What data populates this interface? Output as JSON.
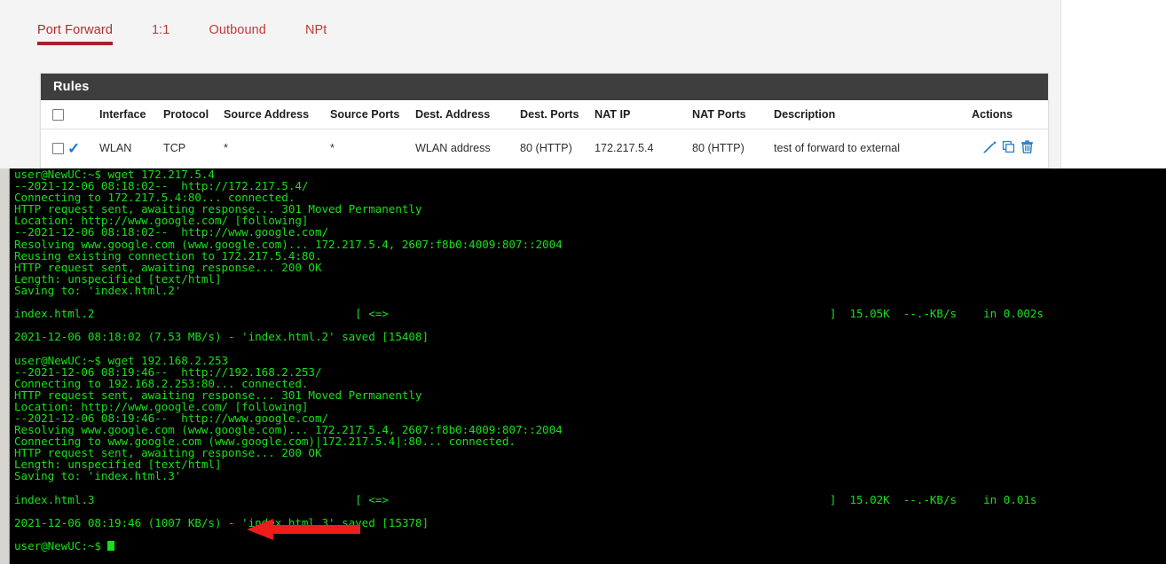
{
  "tabs": [
    {
      "label": "Port Forward",
      "active": true
    },
    {
      "label": "1:1",
      "active": false
    },
    {
      "label": "Outbound",
      "active": false
    },
    {
      "label": "NPt",
      "active": false
    }
  ],
  "rules_card": {
    "title": "Rules",
    "columns": [
      "",
      "",
      "Interface",
      "Protocol",
      "Source Address",
      "Source Ports",
      "Dest. Address",
      "Dest. Ports",
      "NAT IP",
      "NAT Ports",
      "Description",
      "Actions"
    ],
    "rows": [
      {
        "enabled": true,
        "interface": "WLAN",
        "protocol": "TCP",
        "source_address": "*",
        "source_ports": "*",
        "dest_address": "WLAN address",
        "dest_ports": "80 (HTTP)",
        "nat_ip": "172.217.5.4",
        "nat_ports": "80 (HTTP)",
        "description": "test of forward to external",
        "actions": [
          "edit-icon",
          "copy-icon",
          "delete-icon"
        ]
      }
    ]
  },
  "terminal": {
    "prompt": "user@NewUC:~$",
    "lines": [
      "user@NewUC:~$ wget 172.217.5.4",
      "--2021-12-06 08:18:02--  http://172.217.5.4/",
      "Connecting to 172.217.5.4:80... connected.",
      "HTTP request sent, awaiting response... 301 Moved Permanently",
      "Location: http://www.google.com/ [following]",
      "--2021-12-06 08:18:02--  http://www.google.com/",
      "Resolving www.google.com (www.google.com)... 172.217.5.4, 2607:f8b0:4009:807::2004",
      "Reusing existing connection to 172.217.5.4:80.",
      "HTTP request sent, awaiting response... 200 OK",
      "Length: unspecified [text/html]",
      "Saving to: 'index.html.2'",
      "",
      "index.html.2                                       [ <=>                                                                  ]  15.05K  --.-KB/s    in 0.002s",
      "",
      "2021-12-06 08:18:02 (7.53 MB/s) - 'index.html.2' saved [15408]",
      "",
      "user@NewUC:~$ wget 192.168.2.253",
      "--2021-12-06 08:19:46--  http://192.168.2.253/",
      "Connecting to 192.168.2.253:80... connected.",
      "HTTP request sent, awaiting response... 301 Moved Permanently",
      "Location: http://www.google.com/ [following]",
      "--2021-12-06 08:19:46--  http://www.google.com/",
      "Resolving www.google.com (www.google.com)... 172.217.5.4, 2607:f8b0:4009:807::2004",
      "Connecting to www.google.com (www.google.com)|172.217.5.4|:80... connected.",
      "HTTP request sent, awaiting response... 200 OK",
      "Length: unspecified [text/html]",
      "Saving to: 'index.html.3'",
      "",
      "index.html.3                                       [ <=>                                                                  ]  15.02K  --.-KB/s    in 0.01s",
      "",
      "2021-12-06 08:19:46 (1007 KB/s) - 'index.html.3' saved [15378]",
      ""
    ],
    "final_prompt": "user@NewUC:~$ "
  },
  "annotation": {
    "type": "arrow",
    "direction": "left",
    "color": "#ee1c1c",
    "points_at": "user@NewUC:~$ wget 192.168.2.253"
  },
  "colors": {
    "accent_red": "#b32b2e",
    "header_bar": "#3e3e3e",
    "icon_blue": "#2f81c7",
    "terminal_green": "#17e017",
    "terminal_bg": "#000000",
    "panel_bg": "#f4f4f4"
  }
}
